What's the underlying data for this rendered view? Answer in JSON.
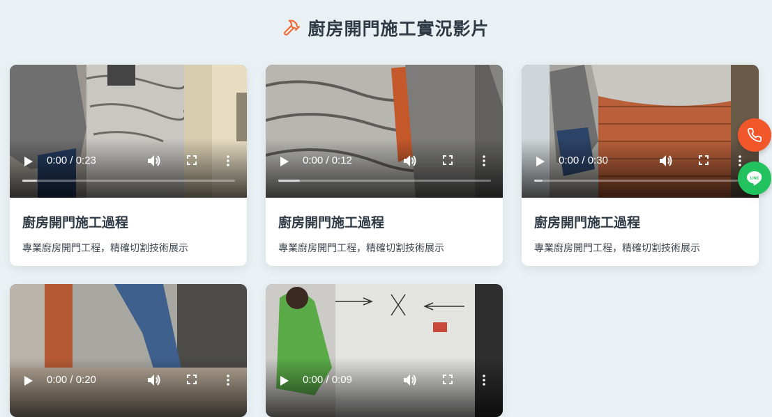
{
  "header": {
    "icon": "hammer-icon",
    "title": "廚房開門施工實況影片",
    "accent": "#f06a38"
  },
  "videos": [
    {
      "time": "0:00 / 0:23",
      "progress": 0.07,
      "title": "廚房開門施工過程",
      "desc": "專業廚房開門工程，精確切割技術展示"
    },
    {
      "time": "0:00 / 0:12",
      "progress": 0.1,
      "title": "廚房開門施工過程",
      "desc": "專業廚房開門工程，精確切割技術展示"
    },
    {
      "time": "0:00 / 0:30",
      "progress": 0.04,
      "title": "廚房開門施工過程",
      "desc": "專業廚房開門工程，精確切割技術展示"
    },
    {
      "time": "0:00 / 0:20"
    },
    {
      "time": "0:00 / 0:09"
    }
  ],
  "fabs": {
    "phone": {
      "icon": "phone-icon",
      "color": "#f2562b"
    },
    "line": {
      "icon": "line-icon",
      "label": "LINE",
      "color": "#22c35e"
    }
  }
}
